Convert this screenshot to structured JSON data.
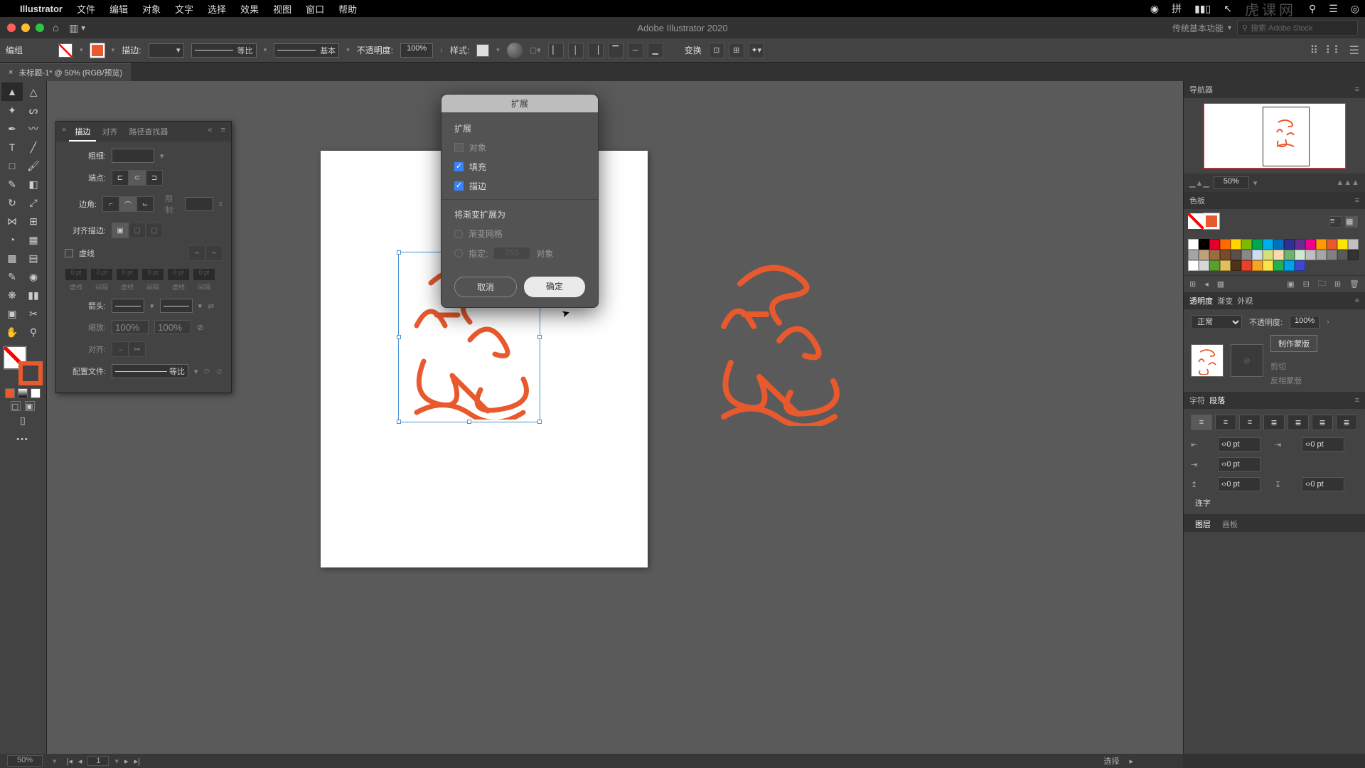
{
  "menubar": {
    "app": "Illustrator",
    "items": [
      "文件",
      "编辑",
      "对象",
      "文字",
      "选择",
      "效果",
      "视图",
      "窗口",
      "帮助"
    ],
    "watermark": "虎课网"
  },
  "titlebar": {
    "app_title": "Adobe Illustrator 2020",
    "workspace": "传统基本功能",
    "search_placeholder": "搜索 Adobe Stock"
  },
  "optbar": {
    "mode": "编组",
    "stroke_label": "描边:",
    "stroke_weight": "",
    "profile": "等比",
    "brush": "基本",
    "opacity_label": "不透明度:",
    "opacity": "100%",
    "style_label": "样式:",
    "transform_label": "变换"
  },
  "doctab": {
    "title": "未标题-1* @ 50% (RGB/预览)"
  },
  "stroke_panel": {
    "tabs": [
      "描边",
      "对齐",
      "路径查找器"
    ],
    "active_tab": 0,
    "weight_label": "粗细:",
    "weight": "",
    "cap_label": "端点:",
    "join_label": "边角:",
    "limit_label": "限制:",
    "limit_value": "",
    "limit_x": "x",
    "align_label": "对齐描边:",
    "dashed_label": "虚线",
    "dash_labels": [
      "虚线",
      "间隔",
      "虚线",
      "间隔",
      "虚线",
      "间隔"
    ],
    "dash_values": [
      "0 pt",
      "0 pt",
      "0 pt",
      "0 pt",
      "0 pt",
      "0 pt"
    ],
    "arrow_label": "箭头:",
    "scale_label": "缩放:",
    "scale1": "100%",
    "scale2": "100%",
    "arrow_align_label": "对齐:",
    "profile_label": "配置文件:",
    "profile": "等比"
  },
  "dialog": {
    "title": "扩展",
    "group1": "扩展",
    "opt_object": "对象",
    "opt_fill": "填充",
    "opt_stroke": "描边",
    "group2": "将渐变扩展为",
    "opt_mesh": "渐变网格",
    "opt_specify": "指定:",
    "spec_value": "255",
    "spec_unit": "对象",
    "cancel": "取消",
    "ok": "确定"
  },
  "nav": {
    "title": "导航器",
    "zoom": "50%"
  },
  "swatches": {
    "title": "色板",
    "colors": [
      "#ffffff",
      "#000000",
      "#e4002b",
      "#ff6a00",
      "#ffd400",
      "#7fba00",
      "#00a651",
      "#00aeef",
      "#0072bc",
      "#2e3192",
      "#662d91",
      "#ec008c",
      "#ff9900",
      "#e85a2e",
      "#ffe600",
      "#c0c0c0",
      "#a5a5a5",
      "#bfa27a",
      "#9c6b3f",
      "#7a4b2b",
      "#59504a",
      "#888888",
      "#cde",
      "#d3e07b",
      "#fcd9b0",
      "#6fb36f",
      "#cfe8cf",
      "#bfbfbf",
      "#a6a6a6",
      "#808080",
      "#595959",
      "#333333",
      "#ffffff",
      "#d6d6d6",
      "#5aa02c",
      "#e0c05a",
      "#503218",
      "#e8412c",
      "#f6a623",
      "#ffe14d",
      "#22b14c",
      "#00a2e8",
      "#3f48cc"
    ]
  },
  "transparency": {
    "tabs": [
      "透明度",
      "渐变",
      "外观"
    ],
    "active": 0,
    "blend": "正常",
    "opacity_label": "不透明度:",
    "opacity": "100%",
    "make_mask": "制作蒙版",
    "clip": "剪切",
    "invert": "反相蒙版"
  },
  "paragraph": {
    "tabs": [
      "字符",
      "段落"
    ],
    "active": 1,
    "left_indent": "0 pt",
    "right_indent": "0 pt",
    "first_indent": "0 pt",
    "space_before": "0 pt",
    "space_after": "0 pt",
    "hyphenate": "连字"
  },
  "layers": {
    "tabs": [
      "图层",
      "画板"
    ],
    "active": 0
  },
  "status": {
    "zoom": "50%",
    "page": "1",
    "tool": "选择"
  }
}
